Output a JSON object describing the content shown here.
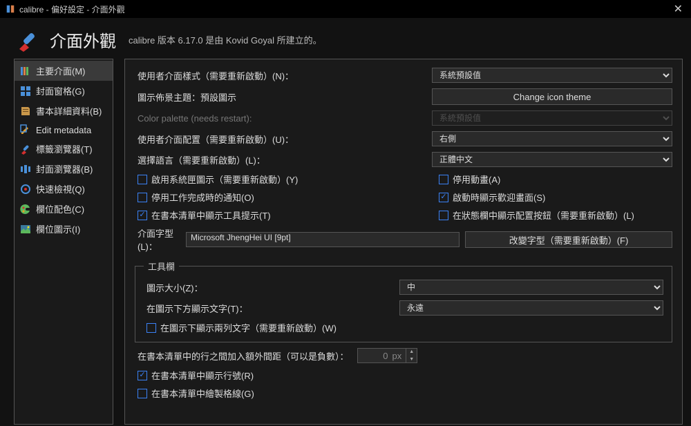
{
  "title": "calibre - 偏好設定 - 介面外觀",
  "header": {
    "title": "介面外觀",
    "subtitle": "calibre 版本 6.17.0 是由 Kovid Goyal 所建立的。"
  },
  "sidebar": [
    {
      "label": "主要介面(M)"
    },
    {
      "label": "封面窗格(G)"
    },
    {
      "label": "書本詳細資料(B)"
    },
    {
      "label": "Edit metadata"
    },
    {
      "label": "標籤瀏覽器(T)"
    },
    {
      "label": "封面瀏覽器(B)"
    },
    {
      "label": "快速檢視(Q)"
    },
    {
      "label": "欄位配色(C)"
    },
    {
      "label": "欄位圖示(I)"
    }
  ],
  "main": {
    "ui_style_label": "使用者介面樣式（需要重新啟動）(N)：",
    "ui_style_value": "系統預設值",
    "icon_theme_label": "圖示佈景主題：預設圖示",
    "icon_theme_btn": "Change icon theme",
    "palette_label": "Color palette (needs restart):",
    "palette_value": "系統預設值",
    "layout_label": "使用者介面配置（需要重新啟動）(U)：",
    "layout_value": "右側",
    "lang_label": "選擇語言（需要重新啟動）(L)：",
    "lang_value": "正體中文",
    "chk_systray": "啟用系統匣圖示（需要重新啟動）(Y)",
    "chk_anim": "停用動畫(A)",
    "chk_notify": "停用工作完成時的通知(O)",
    "chk_welcome": "啟動時顯示歡迎畫面(S)",
    "chk_tooltip": "在書本清單中顯示工具提示(T)",
    "chk_status": "在狀態欄中顯示配置按鈕（需要重新啟動）(L)",
    "font_label": "介面字型(L)：",
    "font_value": "Microsoft JhengHei UI [9pt]",
    "font_btn": "改變字型（需要重新啟動）(F)",
    "toolbar_legend": "工具欄",
    "icon_size_label": "圖示大小(Z)：",
    "icon_size_value": "中",
    "text_under_label": "在圖示下方顯示文字(T)：",
    "text_under_value": "永遠",
    "chk_two_lines": "在圖示下顯示兩列文字（需要重新啟動）(W)",
    "spacing_label": "在書本清單中的行之間加入額外間距（可以是負數）：",
    "spacing_value": "0",
    "spacing_unit": "px",
    "chk_row_num": "在書本清單中顯示行號(R)",
    "chk_gridlines": "在書本清單中繪製格線(G)"
  },
  "checked": {
    "systray": false,
    "anim": false,
    "notify": false,
    "welcome": true,
    "tooltip": true,
    "status": false,
    "two_lines": false,
    "row_num": true,
    "gridlines": false
  }
}
